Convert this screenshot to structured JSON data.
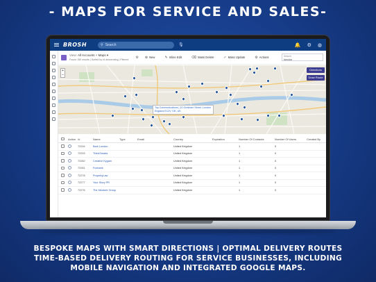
{
  "headline": "- MAPS FOR SERVICE AND SALES-",
  "caption": {
    "line1": "BESPOKE MAPS WITH SMART DIRECTIONS | OPTIMAL DELIVERY ROUTES",
    "line2": "TIME-BASED DELIVERY ROUTING FOR SERVICE BUSINESSES, INCLUDING",
    "line3": "MOBILE NAVIGATION AND INTEGRATED GOOGLE MAPS."
  },
  "app": {
    "logo": "BROSH",
    "search_placeholder": "Search"
  },
  "toolbar": {
    "view_label": "View:",
    "view_name": "All Accounts + Maps",
    "results": "Found 150 results | Sorted by Id descending | Filtered",
    "new_label": "New",
    "inline_edit_label": "Inline Edit",
    "mass_delete_label": "Mass Delete",
    "mass_update_label": "Mass Update",
    "actions_label": "Actions",
    "search_label": "Search",
    "search_value": "london"
  },
  "map": {
    "directions_label": "Directions",
    "draw_route_label": "Draw Route",
    "zoom_in": "+",
    "zoom_out": "–",
    "tooltip_line1": "Top Communications | 10 Gresham Street, London",
    "tooltip_line2": "England EC2V 7JE, UK"
  },
  "grid": {
    "columns": [
      "Action",
      "Id",
      "Name",
      "Type",
      "Email",
      "Country",
      "Expiration",
      "Number Of Contacts",
      "Number Of Users",
      "Created By"
    ],
    "rows": [
      {
        "id": "72294",
        "name": "Bark London",
        "country": "United Kingdom",
        "contacts": "1",
        "users": "0"
      },
      {
        "id": "72293",
        "name": "ThinkSmarts",
        "country": "United Kingdom",
        "contacts": "1",
        "users": "0"
      },
      {
        "id": "72282",
        "name": "Creative Kygam",
        "country": "United Kingdom",
        "contacts": "1",
        "users": "0"
      },
      {
        "id": "72281",
        "name": "Funbank",
        "country": "United Kingdom",
        "contacts": "1",
        "users": "0"
      },
      {
        "id": "72278",
        "name": "PropertyLaw",
        "country": "United Kingdom",
        "contacts": "1",
        "users": "0"
      },
      {
        "id": "72277",
        "name": "Your Story PR",
        "country": "United Kingdom",
        "contacts": "1",
        "users": "0"
      },
      {
        "id": "72276",
        "name": "The Mentoré Group",
        "country": "United Kingdom",
        "contacts": "1",
        "users": "0"
      }
    ]
  }
}
